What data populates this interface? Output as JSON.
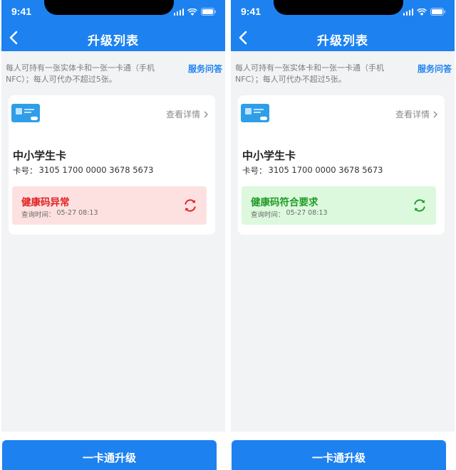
{
  "colors": {
    "brand": "#1d82f0",
    "danger": "#e02020",
    "success": "#1f9b25",
    "danger_bg": "#fde1e1",
    "success_bg": "#dcf9dd"
  },
  "screens": [
    {
      "status_bar": {
        "time": "9:41"
      },
      "nav": {
        "title": "升级列表",
        "back_icon": "chevron-left-icon"
      },
      "notice": {
        "text": "每人可持有一张实体卡和一张一卡通（手机NFC）；每人可代办不超过5张。",
        "link": "服务问答"
      },
      "card": {
        "detail_link": "查看详情",
        "name": "中小学生卡",
        "number_label": "卡号：",
        "number": "3105 1700 0000 3678 5673",
        "health": {
          "status": "健康码异常",
          "state": "abnormal",
          "time_label": "查询时间：",
          "time": "05-27 08:13",
          "icon": "refresh-icon"
        }
      },
      "upgrade_button": "一卡通升级"
    },
    {
      "status_bar": {
        "time": "9:41"
      },
      "nav": {
        "title": "升级列表",
        "back_icon": "chevron-left-icon"
      },
      "notice": {
        "text": "每人可持有一张实体卡和一张一卡通（手机NFC）；每人可代办不超过5张。",
        "link": "服务问答"
      },
      "card": {
        "detail_link": "查看详情",
        "name": "中小学生卡",
        "number_label": "卡号：",
        "number": "3105 1700 0000 3678 5673",
        "health": {
          "status": "健康码符合要求",
          "state": "normal",
          "time_label": "查询时间：",
          "time": "05-27 08:13",
          "icon": "refresh-icon"
        }
      },
      "upgrade_button": "一卡通升级"
    }
  ]
}
